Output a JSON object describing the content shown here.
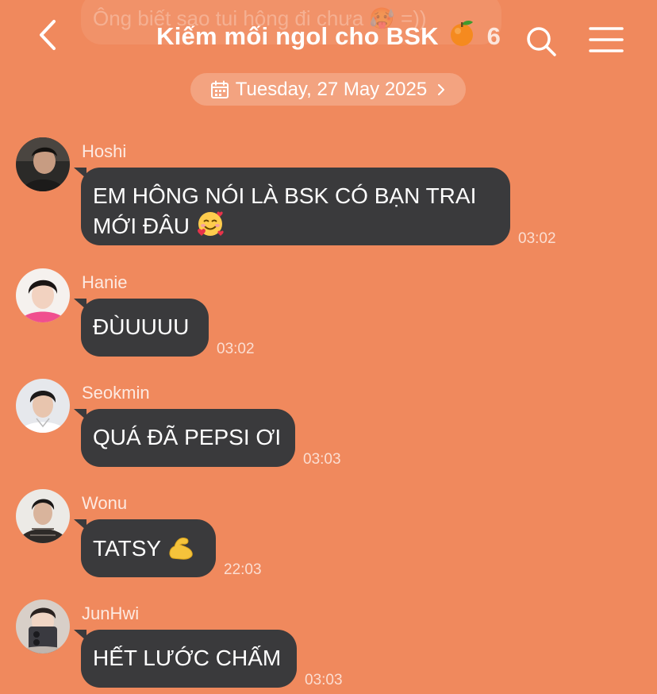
{
  "colors": {
    "background": "#F0895D",
    "bubble": "#3A3A3C",
    "text": "#FFFFFF"
  },
  "header": {
    "title": "Kiếm mối ngol cho BSK",
    "title_emoji": "orange-fruit-icon",
    "member_count": "6",
    "back_icon": "chevron-left-icon",
    "search_icon": "search-icon",
    "menu_icon": "menu-icon"
  },
  "previous_message": {
    "text": "Ông biết sao tui hông đi chưa 🥵 =))"
  },
  "date_separator": {
    "label": "Tuesday, 27 May 2025",
    "icon": "calendar-icon"
  },
  "messages": [
    {
      "sender": "Hoshi",
      "text_line1": "EM HÔNG NÓI LÀ BSK CÓ BẠN TRAI",
      "text_line2": "MỚI ĐÂU",
      "emoji": "smiling-face-with-hearts-icon",
      "time": "03:02"
    },
    {
      "sender": "Hanie",
      "text": "ĐÙUUUU",
      "time": "03:02"
    },
    {
      "sender": "Seokmin",
      "text": "QUÁ ĐÃ PEPSI ƠI",
      "time": "03:03"
    },
    {
      "sender": "Wonu",
      "text": "TATSY",
      "emoji": "flexed-biceps-icon",
      "time": "22:03"
    },
    {
      "sender": "JunHwi",
      "text": "HẾT LƯỚC CHẤM",
      "time": "03:03"
    }
  ]
}
